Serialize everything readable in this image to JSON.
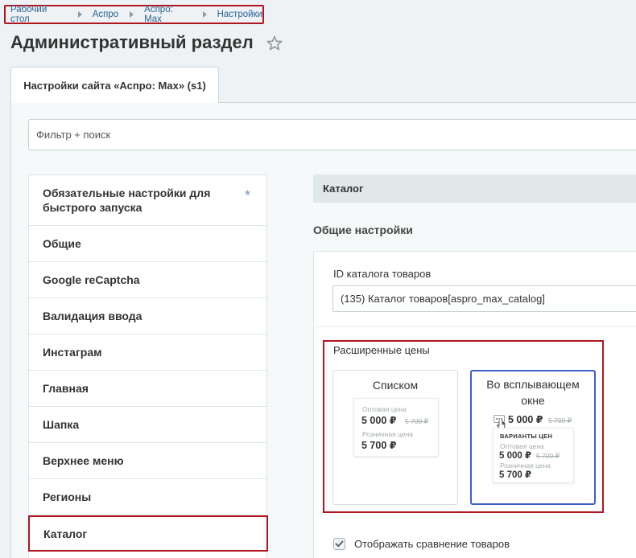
{
  "breadcrumb": [
    "Рабочий стол",
    "Аспро",
    "Аспро: Max",
    "Настройки"
  ],
  "page_title": "Административный раздел",
  "tab_label": "Настройки сайта «Аспро: Max» (s1)",
  "filter_placeholder": "Фильтр + поиск",
  "sidebar": {
    "items": [
      "Обязательные настройки для быстрого запуска",
      "Общие",
      "Google reCaptcha",
      "Валидация ввода",
      "Инстаграм",
      "Главная",
      "Шапка",
      "Верхнее меню",
      "Регионы",
      "Каталог"
    ],
    "active_index": 9
  },
  "section": {
    "header": "Каталог",
    "subheading": "Общие настройки",
    "catalog_id_label": "ID каталога товаров",
    "catalog_id_value": "(135) Каталог товаров[aspro_max_catalog]",
    "extended_prices_label": "Расширенные цены",
    "options": [
      {
        "title": "Списком",
        "wholesale_label": "Оптовая цена",
        "wholesale_price": "5 000 ₽",
        "wholesale_old": "5 700 ₽",
        "retail_label": "Розничная цена",
        "retail_price": "5 700 ₽"
      },
      {
        "title": "Во всплывающем окне",
        "main_price": "5 000 ₽",
        "main_old": "5 700 ₽",
        "popup_heading": "ВАРИАНТЫ ЦЕН",
        "wholesale_label": "Оптовая цена",
        "wholesale_price": "5 000 ₽",
        "wholesale_old": "5 700 ₽",
        "retail_label": "Розничная цена",
        "retail_price": "5 700 ₽"
      }
    ],
    "selected_option": 1,
    "compare_checkbox_label": "Отображать сравнение товаров",
    "compare_checked": true
  },
  "colors": {
    "highlight": "#b0161f",
    "link": "#2a6496",
    "selected_border": "#3f5fc4"
  }
}
